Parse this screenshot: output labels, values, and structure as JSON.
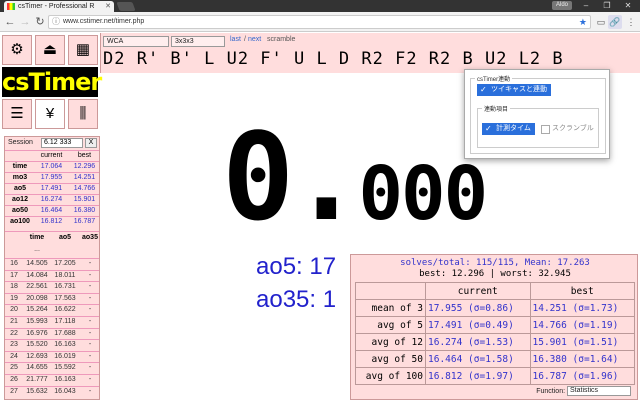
{
  "browser": {
    "tab_title": "csTimer - Professional R",
    "url": "www.cstimer.net/timer.php",
    "profile": "Aldo"
  },
  "toolbar": {
    "event": "WCA",
    "puzzle": "3x3x3",
    "last_label": "last",
    "next_label": "next",
    "scramble_label": "scramble",
    "scramble": "D2 R' B' L U2 F' U L D R2 F2 R2 B U2 L2 B"
  },
  "logo": {
    "text": "csTimer"
  },
  "icons": {
    "row1": [
      "gear-icon",
      "upload-icon",
      "grid-icon"
    ],
    "row2": [
      "list-icon",
      "yen-icon",
      "sliders-icon"
    ]
  },
  "session": {
    "label": "Session",
    "value": "6.12 333",
    "close": "X",
    "headers": [
      "",
      "current",
      "best"
    ],
    "rows": [
      [
        "time",
        "17.064",
        "12.296"
      ],
      [
        "mo3",
        "17.955",
        "14.251"
      ],
      [
        "ao5",
        "17.491",
        "14.766"
      ],
      [
        "ao12",
        "16.274",
        "15.901"
      ],
      [
        "ao50",
        "16.464",
        "16.380"
      ],
      [
        "ao100",
        "16.812",
        "16.787"
      ]
    ],
    "list_headers": [
      "",
      "time",
      "ao5",
      "ao35"
    ],
    "ellipsis": "...",
    "list": [
      [
        "16",
        "14.505",
        "17.205",
        "-"
      ],
      [
        "17",
        "14.084",
        "18.011",
        "-"
      ],
      [
        "18",
        "22.561",
        "16.731",
        "-"
      ],
      [
        "19",
        "20.098",
        "17.563",
        "-"
      ],
      [
        "20",
        "15.264",
        "16.622",
        "-"
      ],
      [
        "21",
        "15.993",
        "17.118",
        "-"
      ],
      [
        "22",
        "16.976",
        "17.688",
        "-"
      ],
      [
        "23",
        "15.520",
        "16.163",
        "-"
      ],
      [
        "24",
        "12.693",
        "16.019",
        "-"
      ],
      [
        "25",
        "14.655",
        "15.592",
        "-"
      ],
      [
        "26",
        "21.777",
        "16.163",
        "-"
      ],
      [
        "27",
        "15.632",
        "16.043",
        "-"
      ]
    ]
  },
  "timer": {
    "main": "0.",
    "decimals": "000"
  },
  "big_averages": {
    "ao5": "ao5: 17",
    "ao35": "ao35: 1"
  },
  "stats_popup": {
    "line1": "solves/total: 115/115, Mean: 17.263",
    "line2": "best: 12.296 | worst: 32.945",
    "headers": [
      "",
      "current",
      "best"
    ],
    "rows": [
      [
        "mean of 3",
        "17.955 (σ=0.86)",
        "14.251 (σ=1.73)"
      ],
      [
        "avg of 5",
        "17.491 (σ=0.49)",
        "14.766 (σ=1.19)"
      ],
      [
        "avg of 12",
        "16.274 (σ=1.53)",
        "15.901 (σ=1.51)"
      ],
      [
        "avg of 50",
        "16.464 (σ=1.58)",
        "16.380 (σ=1.64)"
      ],
      [
        "avg of 100",
        "16.812 (σ=1.97)",
        "16.787 (σ=1.96)"
      ]
    ],
    "function_label": "Function:",
    "function_value": "Statistics"
  },
  "extension": {
    "legend1": "csTimer連動",
    "check1": "ツイキャスと連動",
    "legend2": "連動項目",
    "check2": "計測タイム",
    "check3": "スクランブル"
  }
}
